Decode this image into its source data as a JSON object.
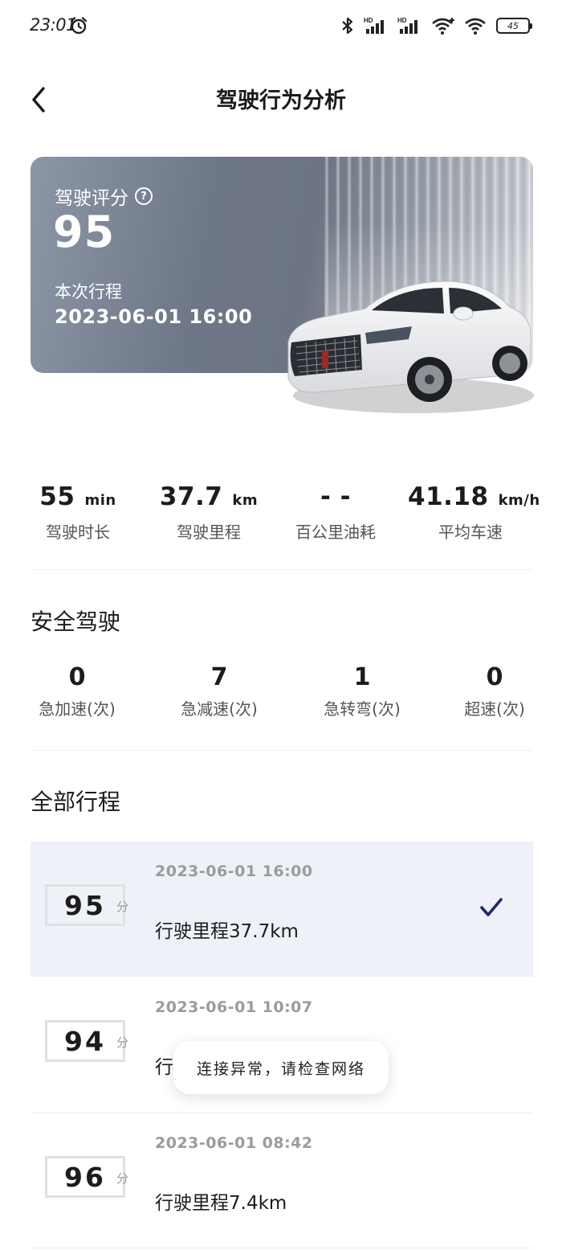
{
  "status_bar": {
    "time": "23:01",
    "battery": "45",
    "icons": [
      "alarm-icon",
      "bluetooth-icon",
      "signal-hd-icon",
      "signal-hd-icon",
      "wifi-icon",
      "wifi-icon",
      "battery-icon"
    ]
  },
  "header": {
    "title": "驾驶行为分析"
  },
  "score_card": {
    "label": "驾驶评分",
    "score": "95",
    "trip_label": "本次行程",
    "trip_time": "2023-06-01  16:00"
  },
  "metrics": [
    {
      "value": "55",
      "unit": "min",
      "label": "驾驶时长"
    },
    {
      "value": "37.7",
      "unit": "km",
      "label": "驾驶里程"
    },
    {
      "value": "- -",
      "unit": "",
      "label": "百公里油耗"
    },
    {
      "value": "41.18",
      "unit": "km/h",
      "label": "平均车速"
    }
  ],
  "safety": {
    "title": "安全驾驶",
    "items": [
      {
        "count": "0",
        "label": "急加速(次)"
      },
      {
        "count": "7",
        "label": "急减速(次)"
      },
      {
        "count": "1",
        "label": "急转弯(次)"
      },
      {
        "count": "0",
        "label": "超速(次)"
      }
    ]
  },
  "trips": {
    "title": "全部行程",
    "unit": "分",
    "items": [
      {
        "score": "95",
        "datetime": "2023-06-01  16:00",
        "distance": "行驶里程37.7km",
        "selected": true
      },
      {
        "score": "94",
        "datetime": "2023-06-01  10:07",
        "distance": "行",
        "selected": false
      },
      {
        "score": "96",
        "datetime": "2023-06-01  08:42",
        "distance": "行驶里程7.4km",
        "selected": false
      }
    ]
  },
  "toast": {
    "message": "连接异常，请检查网络"
  },
  "colors": {
    "accent": "#1f2a6b",
    "selected_bg": "#eff1f8"
  }
}
